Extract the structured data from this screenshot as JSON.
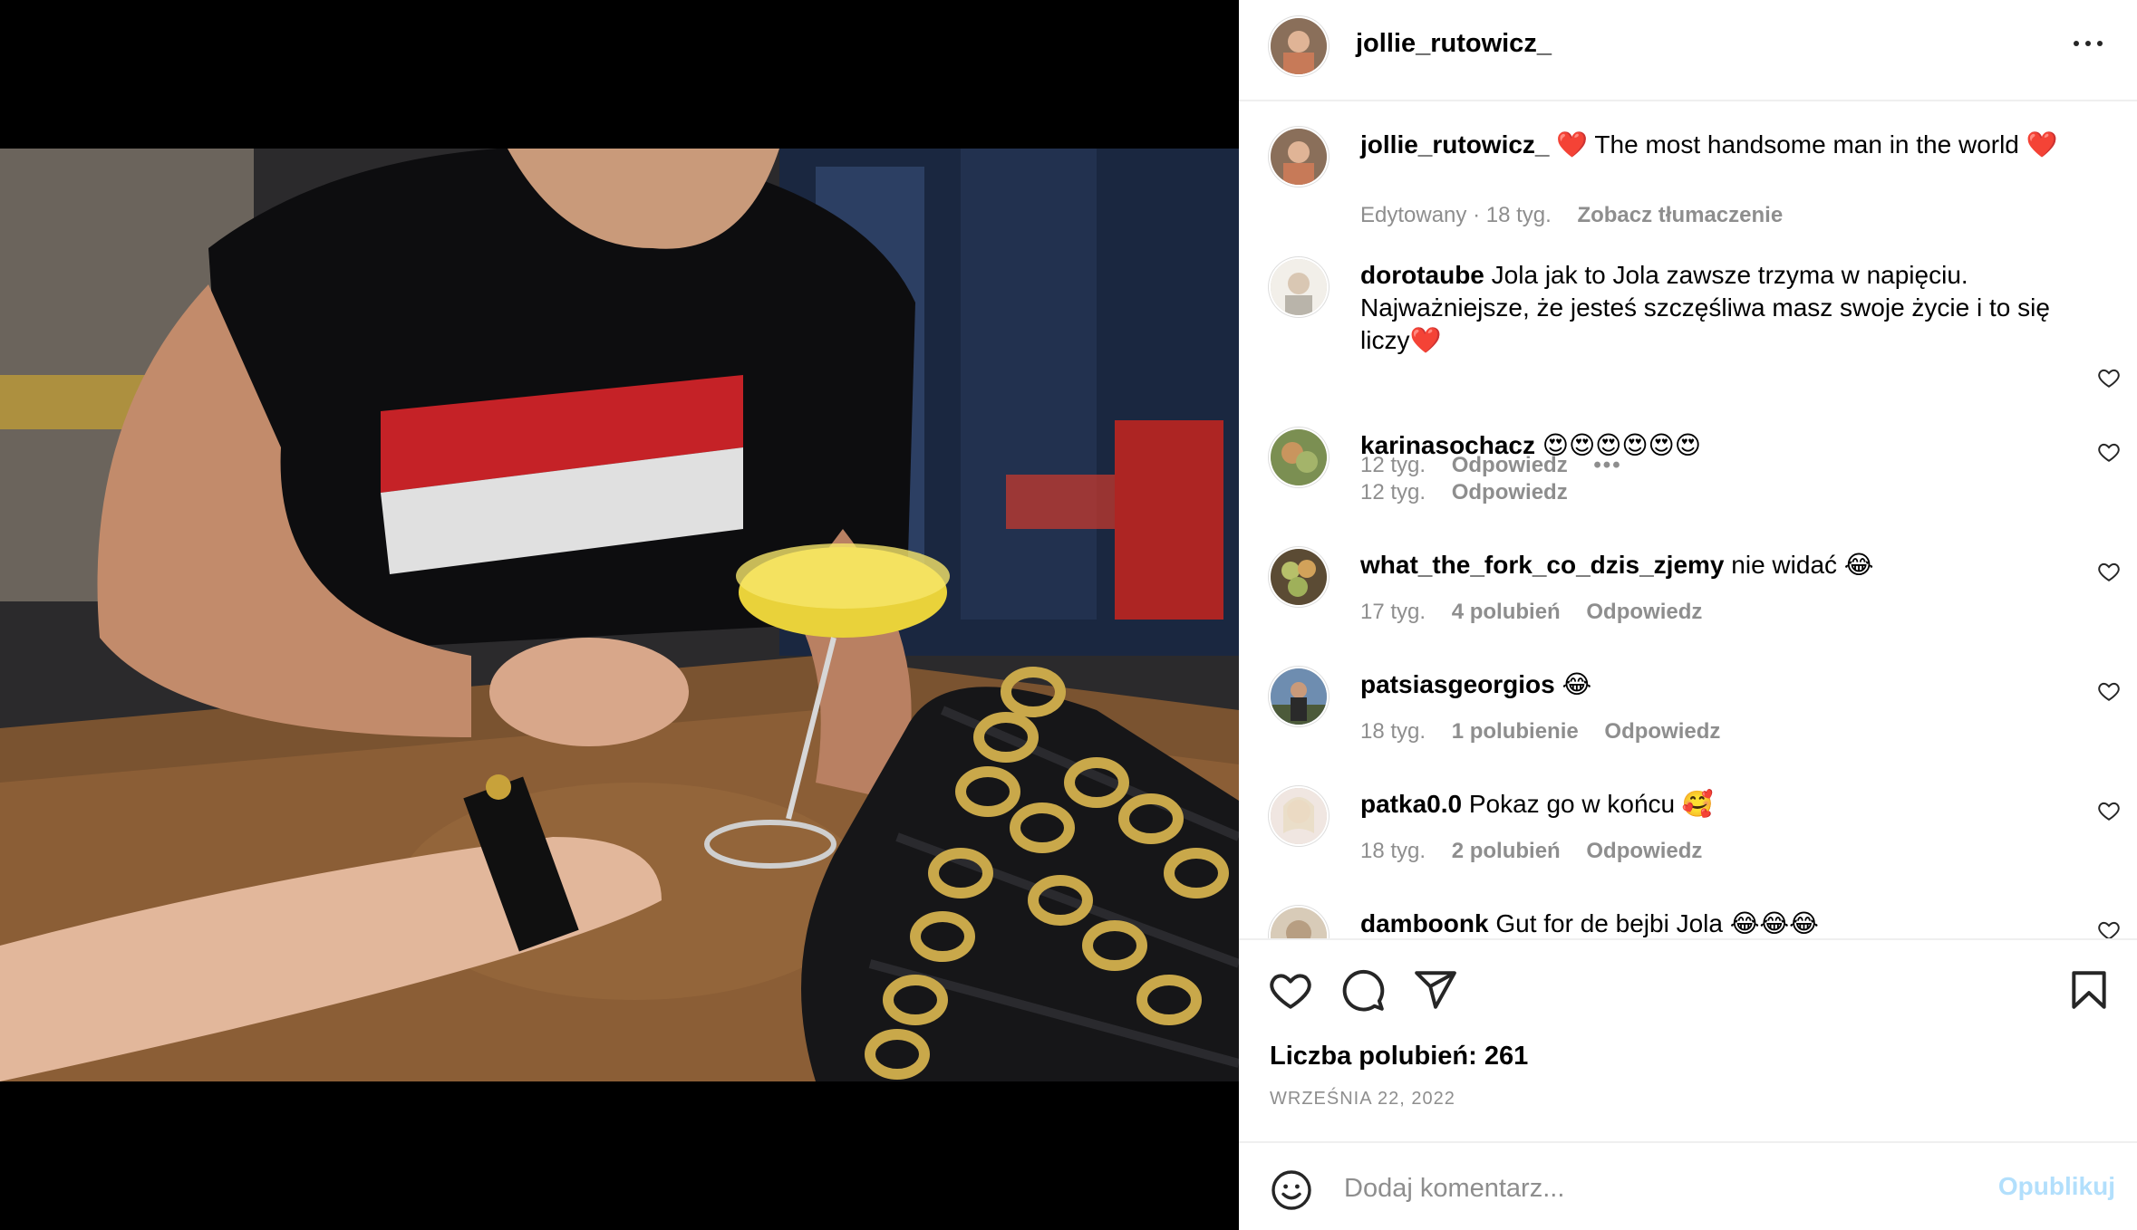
{
  "post": {
    "username": "jollie_rutowicz_",
    "caption_prefix": "❤️",
    "caption": " The most handsome man in the world ❤️",
    "caption_meta": {
      "edited": "Edytowany · 18 tyg.",
      "translate": "Zobacz tłumaczenie"
    }
  },
  "comments": [
    {
      "username": "dorotaube",
      "text": " Jola jak to Jola zawsze trzyma w napięciu. Najważniejsze, że jesteś szczęśliwa masz swoje życie i to się liczy❤️",
      "time": "12 tyg.",
      "likes": "",
      "reply": "Odpowiedz",
      "more": "•••"
    },
    {
      "username": "karinasochacz",
      "text": " 😍😍😍😍😍😍",
      "time": "12 tyg.",
      "likes": "",
      "reply": "Odpowiedz"
    },
    {
      "username": "what_the_fork_co_dzis_zjemy",
      "text": " nie widać 😂",
      "time": "17 tyg.",
      "likes": "4 polubień",
      "reply": "Odpowiedz"
    },
    {
      "username": "patsiasgeorgios",
      "text": " 😂",
      "time": "18 tyg.",
      "likes": "1 polubienie",
      "reply": "Odpowiedz"
    },
    {
      "username": "patka0.0",
      "text": " Pokaz go w końcu 🥰",
      "time": "18 tyg.",
      "likes": "2 polubień",
      "reply": "Odpowiedz"
    },
    {
      "username": "damboonk",
      "text": " Gut for de bejbi Jola 😂😂😂",
      "time": "",
      "likes": "",
      "reply": ""
    }
  ],
  "footer": {
    "likes_label": "Liczba polubień: 261",
    "date": "WRZEŚNIA 22, 2022",
    "comment_placeholder": "Dodaj komentarz...",
    "publish_label": "Opublikuj"
  },
  "icons": {
    "like": "heart-icon",
    "comment": "comment-icon",
    "share": "send-icon",
    "save": "bookmark-icon",
    "emoji": "smiley-icon",
    "options": "more-options-icon"
  },
  "colors": {
    "text": "#000000",
    "muted": "#8e8e8e",
    "publish_disabled": "#b2dffc",
    "divider": "#efefef"
  }
}
